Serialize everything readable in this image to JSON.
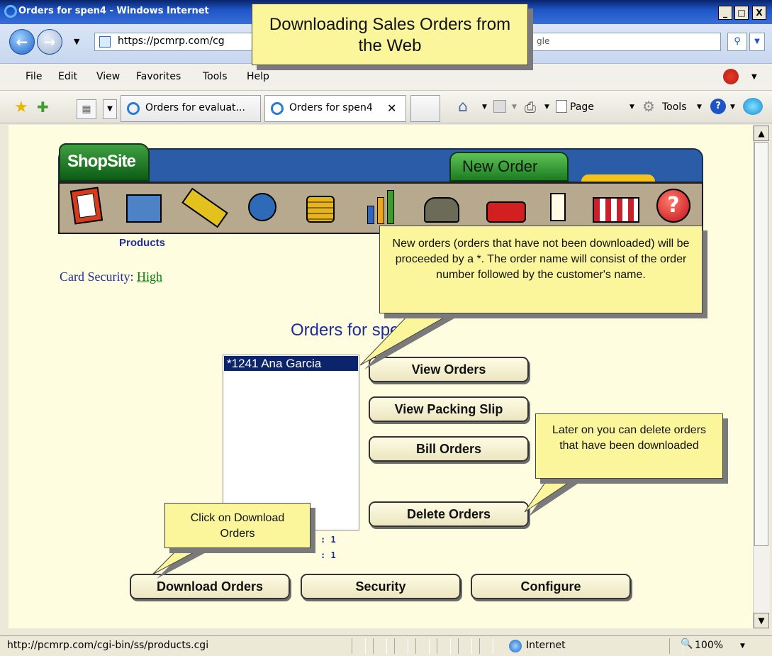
{
  "window": {
    "title": "Orders for spen4 - Windows Internet",
    "controls": [
      "_",
      "□",
      "X"
    ]
  },
  "address": {
    "url": "https://pcmrp.com/cg",
    "search_text": "gle"
  },
  "menu": [
    "File",
    "Edit",
    "View",
    "Favorites",
    "Tools",
    "Help"
  ],
  "tabs": [
    {
      "label": "Orders for evaluat..."
    },
    {
      "label": "Orders for spen4"
    }
  ],
  "commands": {
    "page": "Page",
    "tools": "Tools"
  },
  "shopsite": {
    "logo": "ShopSite",
    "new_order_tab": "New Order",
    "products_label": "Products",
    "card_security_label": "Card Security:",
    "card_security_value": "High"
  },
  "orders": {
    "title": "Orders for spen4\"",
    "items": [
      "*1241 Ana Garcia"
    ],
    "count_1": ": 1",
    "count_2": ": 1"
  },
  "buttons": {
    "view_orders": "View Orders",
    "view_packing_slip": "View Packing Slip",
    "bill_orders": "Bill Orders",
    "delete_orders": "Delete Orders",
    "download_orders": "Download Orders",
    "security": "Security",
    "configure": "Configure"
  },
  "callouts": {
    "header": "Downloading Sales Orders from the Web",
    "new_orders": "New orders (orders that have not been downloaded) will be proceeded by a *.  The order name will consist of the order number followed by the customer's name.",
    "delete": "Later on you can delete orders that have been downloaded",
    "download": "Click on Download Orders"
  },
  "status": {
    "url": "http://pcmrp.com/cgi-bin/ss/products.cgi",
    "zone": "Internet",
    "zoom": "100%"
  }
}
